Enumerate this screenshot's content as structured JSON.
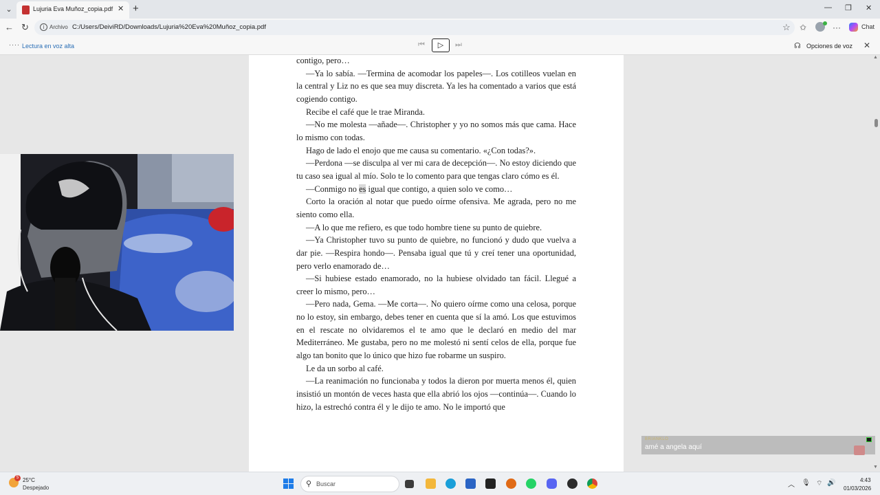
{
  "browser": {
    "tab_title": "Lujuria Eva Muñoz_copia.pdf",
    "address_scheme_label": "Archivo",
    "url": "C:/Users/DeiviRD/Downloads/Lujuria%20Eva%20Muñoz_copia.pdf",
    "chat_label": "Chat"
  },
  "read_aloud": {
    "title": "Lectura en voz alta",
    "voice_options_label": "Opciones de voz"
  },
  "document": {
    "highlighted_word": "es",
    "paragraphs": [
      {
        "text": "contigo, pero…",
        "continuation": true
      },
      {
        "text": "—Ya lo sabía. —Termina de acomodar los papeles—. Los cotilleos vuelan en la central y Liz no es que sea muy discreta. Ya les ha comentado a varios que está cogiendo contigo."
      },
      {
        "text": "Recibe el café que le trae Miranda."
      },
      {
        "text": "—No me molesta —añade—. Christopher y yo no somos más que cama. Hace lo mismo con todas."
      },
      {
        "text": "Hago de lado el enojo que me causa su comentario. «¿Con todas?»."
      },
      {
        "text": "—Perdona —se disculpa al ver mi cara de decepción—. No estoy diciendo que tu caso sea igual al mío. Solo te lo comento para que tengas claro cómo es él."
      },
      {
        "before": "—Conmigo no ",
        "after": " igual que contigo, a quien solo ve como…"
      },
      {
        "text": "Corto la oración al notar que puedo oírme ofensiva. Me agrada, pero no me siento como ella."
      },
      {
        "text": "—A lo que me refiero, es que todo hombre tiene su punto de quiebre."
      },
      {
        "text": "—Ya Christopher tuvo su punto de quiebre, no funcionó y dudo que vuelva a dar pie. —Respira hondo—. Pensaba igual que tú y creí tener una oportunidad, pero verlo enamorado de…"
      },
      {
        "text": "—Si hubiese estado enamorado, no la hubiese olvidado tan fácil. Llegué a creer lo mismo, pero…"
      },
      {
        "text": "—Pero nada, Gema. —Me corta—. No quiero oírme como una celosa, porque no lo estoy, sin embargo, debes tener en cuenta que sí la amó. Los que estuvimos en el rescate no olvidaremos el te amo que le declaró en medio del mar Mediterráneo. Me gustaba, pero no me molestó ni sentí celos de ella, porque fue algo tan bonito que lo único que hizo fue robarme un suspiro."
      },
      {
        "text": "Le da un sorbo al café."
      },
      {
        "text": "—La reanimación no funcionaba y todos la dieron por muerta menos él, quien insistió un montón de veces hasta que ella abrió los ojos —continúa—. Cuando lo hizo, la estrechó contra él y le dijo te amo. No le importó que"
      }
    ]
  },
  "stream_chat": {
    "username": "BRIANKLO",
    "message": "amé a angela aquí"
  },
  "taskbar": {
    "weather_temp": "25°C",
    "weather_desc": "Despejado",
    "weather_badge": "5",
    "search_placeholder": "Buscar",
    "time": "4:43",
    "date": "01/03/2026"
  },
  "colors": {
    "read_aloud_link": "#2a6eb5",
    "page_bg": "#ffffff",
    "viewer_bg": "#e7e7e7",
    "windows_accent": "#1e7ce8"
  }
}
